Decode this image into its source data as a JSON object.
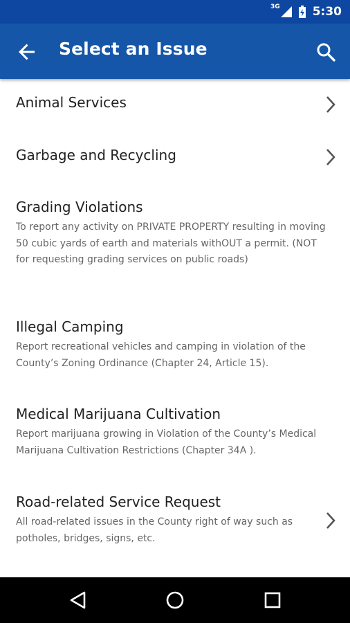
{
  "status_bar": {
    "network": "3G",
    "time": "5:30"
  },
  "app_bar": {
    "title": "Select an Issue",
    "back_icon": "arrow-back-icon",
    "search_icon": "search-icon"
  },
  "colors": {
    "status_bar": "#0d47a1",
    "app_bar": "#1656a8",
    "text_primary": "#222222",
    "text_secondary": "#666666"
  },
  "issues": [
    {
      "title": "Animal Services",
      "description": "",
      "has_chevron": true
    },
    {
      "title": "Garbage and Recycling",
      "description": "",
      "has_chevron": true
    },
    {
      "title": "Grading Violations",
      "description": "To report any activity on PRIVATE PROPERTY resulting in moving 50 cubic yards of earth and materials withOUT a permit.  (NOT for requesting grading services on public roads)",
      "has_chevron": false
    },
    {
      "title": "Illegal Camping",
      "description": "Report recreational vehicles and camping in violation of the County’s Zoning Ordinance (Chapter 24, Article 15).",
      "has_chevron": false
    },
    {
      "title": "Medical Marijuana Cultivation",
      "description": "Report marijuana growing in Violation of the County’s Medical Marijuana Cultivation Restrictions (Chapter 34A ).",
      "has_chevron": false
    },
    {
      "title": "Road-related Service Request",
      "description": "All road-related issues in the County right of way such as potholes, bridges, signs, etc.",
      "has_chevron": true
    }
  ],
  "nav_bar": {
    "back_icon": "nav-back-icon",
    "home_icon": "nav-home-icon",
    "recents_icon": "nav-recents-icon"
  }
}
